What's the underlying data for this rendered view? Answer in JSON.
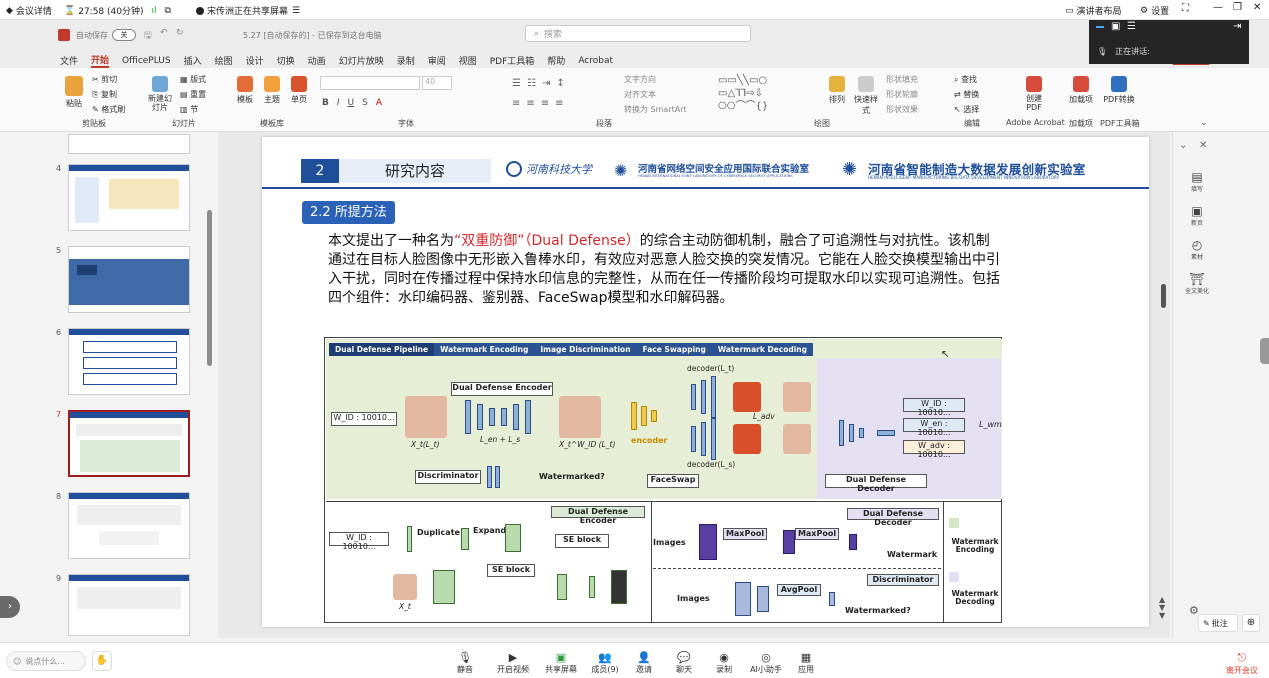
{
  "meeting": {
    "title": "会议详情",
    "timer": "27:58 (40分钟)",
    "sharing": "宋传洲正在共享屏幕",
    "speaker_layout": "演讲者布局",
    "settings": "设置",
    "speaking": "正在讲话:"
  },
  "ppt": {
    "autosave": "自动保存",
    "autosave_state": "关",
    "file_name": "5.27 [自动保存的] - 已保存到这台电脑",
    "search_placeholder": "搜索"
  },
  "menu": [
    "文件",
    "开始",
    "OfficePLUS",
    "插入",
    "绘图",
    "设计",
    "切换",
    "动画",
    "幻灯片放映",
    "录制",
    "审阅",
    "视图",
    "PDF工具箱",
    "帮助",
    "Acrobat"
  ],
  "ribbon": {
    "paste": "粘贴",
    "cut": "剪切",
    "copy": "复制",
    "format_painter": "格式刷",
    "clipboard": "剪贴板",
    "new_slide": "新建幻灯片",
    "layout": "版式",
    "reset": "重置",
    "section": "节",
    "slides": "幻灯片",
    "templates_a": "模板",
    "templates_b": "主题",
    "templates_c": "单页",
    "template_lib": "模板库",
    "font_size": "40",
    "font": "字体",
    "text_dir": "文字方向",
    "align_text": "对齐文本",
    "smartart": "转换为 SmartArt",
    "paragraph": "段落",
    "arrange": "排列",
    "quick_styles": "快速样式",
    "shape_fill": "形状填充",
    "shape_outline": "形状轮廓",
    "shape_effects": "形状效果",
    "drawing": "绘图",
    "find": "查找",
    "replace": "替换",
    "select": "选择",
    "editing": "编辑",
    "create_pdf": "创建PDF",
    "adobe": "Adobe Acrobat",
    "addin": "加载项",
    "addins": "加载项",
    "pdf_convert": "PDF转换",
    "pdf_tools": "PDF工具箱"
  },
  "thumbs": [
    {
      "num": "4"
    },
    {
      "num": "5"
    },
    {
      "num": "6"
    },
    {
      "num": "7"
    },
    {
      "num": "8"
    },
    {
      "num": "9"
    }
  ],
  "slide": {
    "section_num": "2",
    "section_title": "研究内容",
    "uni_cn": "河南科技大学",
    "lab1": "河南省网络空间安全应用国际联合实验室",
    "lab1_en": "HENAN INTERNATIONAL JOINT LABORATORY OF CYBERSPACE SECURITY APPLICATIONS",
    "lab2": "河南省智能制造大数据发展创新实验室",
    "lab2_en": "HENAN INTELLIGENT MANUFACTURING BIG DATA DEVELOPMENT INNOVATION LABORATORY",
    "subtitle": "2.2 所提方法",
    "body_pre": "本文提出了一种名为",
    "body_hl": "“双重防御”（Dual Defense）",
    "body_post": "的综合主动防御机制，融合了可追溯性与对抗性。该机制通过在目标人脸图像中无形嵌入鲁棒水印，有效应对恶意人脸交换的突发情况。它能在人脸交换模型输出中引入干扰，同时在传播过程中保持水印信息的完整性，从而在任一传播阶段均可提取水印以实现可追溯性。包括四个组件：水印编码器、鉴别器、FaceSwap模型和水印解码器。"
  },
  "figure": {
    "pipeline": "Dual Defense Pipeline",
    "steps": [
      "Watermark Encoding",
      "Image Discrimination",
      "Face Swapping",
      "Watermark Decoding"
    ],
    "enc": "Dual Defense Encoder",
    "wid": "W_ID : 10010...",
    "xt": "X_t(L_t)",
    "xwt": "X_t^W_ID (L_t)",
    "loss": "L_en + L_s",
    "dec_t": "decoder(L_t)",
    "dec_s": "decoder(L_s)",
    "encoder": "encoder",
    "faceswap": "FaceSwap",
    "ladv": "L_adv",
    "disc": "Discriminator",
    "wm_q": "Watermarked?",
    "dd_dec": "Dual Defense Decoder",
    "w1": "W_ID : 10010...",
    "w2": "W_en : 10010...",
    "w3": "W_adv : 10010...",
    "lwm": "L_wm",
    "dup": "Duplicate",
    "expand": "Expand",
    "se": "SE block",
    "se2": "SE block",
    "xt2": "X_t",
    "dd_enc2": "Dual Defense Encoder",
    "dd_dec2": "Dual Defense Decoder",
    "images": "Images",
    "maxpool": "MaxPool",
    "maxpool2": "MaxPool",
    "watermark": "Watermark",
    "disc2": "Discriminator",
    "images2": "Images",
    "avgpool": "AvgPool",
    "wm_q2": "Watermarked?",
    "leg1": "Watermark Encoding",
    "leg2": "Watermark Decoding",
    "wid2": "W_ID : 10010..."
  },
  "rightpane": [
    "填写",
    "新页",
    "素材",
    "全文美化"
  ],
  "annotate": "批注",
  "bottom": {
    "say": "说点什么...",
    "mute": "静音",
    "video": "开启视频",
    "share": "共享屏幕",
    "members": "成员(9)",
    "invite": "邀请",
    "chat": "聊天",
    "record": "录制",
    "ai": "AI小助手",
    "apps": "应用",
    "leave": "离开会议"
  }
}
